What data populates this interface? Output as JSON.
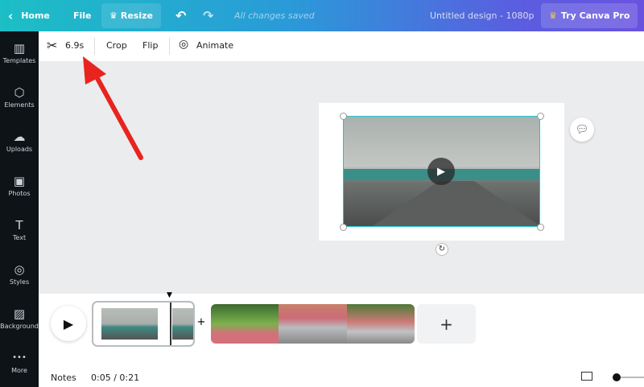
{
  "topbar": {
    "home": "Home",
    "file": "File",
    "resize": "Resize",
    "status": "All changes saved",
    "title": "Untitled design - 1080p",
    "pro": "Try Canva Pro"
  },
  "sidebar": {
    "items": [
      {
        "label": "Templates",
        "icon": "▥"
      },
      {
        "label": "Elements",
        "icon": "⬡"
      },
      {
        "label": "Uploads",
        "icon": "☁"
      },
      {
        "label": "Photos",
        "icon": "▣"
      },
      {
        "label": "Text",
        "icon": "T"
      },
      {
        "label": "Styles",
        "icon": "◎"
      },
      {
        "label": "Background",
        "icon": "▨"
      },
      {
        "label": "More",
        "icon": "•••"
      }
    ]
  },
  "toolbar": {
    "trim": "6.9s",
    "crop": "Crop",
    "flip": "Flip",
    "animate": "Animate"
  },
  "timeline": {
    "notes": "Notes",
    "time": "0:05 / 0:21"
  }
}
